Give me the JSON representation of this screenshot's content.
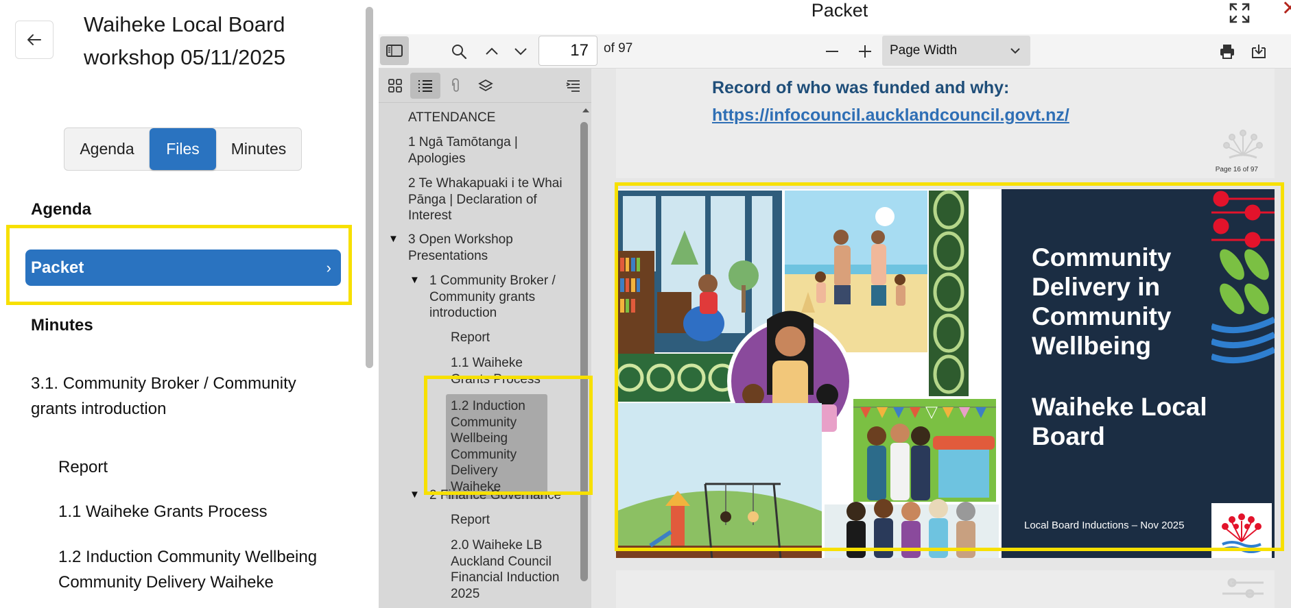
{
  "left_panel": {
    "title": "Waiheke Local Board workshop 05/11/2025",
    "segments": [
      "Agenda",
      "Files",
      "Minutes"
    ],
    "active_segment": "Files",
    "agenda_heading": "Agenda",
    "packet_label": "Packet",
    "minutes_heading": "Minutes",
    "minutes_items": [
      "3.1. Community Broker / Community grants introduction",
      "Report",
      "1.1 Waiheke Grants Process",
      "1.2 Induction Community Wellbeing Community Delivery Waiheke"
    ]
  },
  "viewer": {
    "title": "Packet",
    "current_page": "17",
    "page_total": "of 97",
    "zoom": "Page Width",
    "outline": [
      "ATTENDANCE",
      "1 Ngā Tamōtanga | Apologies",
      "2 Te Whakapuaki i te Whai Pānga | Declaration of Interest",
      "3 Open Workshop Presentations",
      "1 Community Broker / Community grants introduction",
      "Report",
      "1.1 Waiheke Grants Process",
      "1.2 Induction Community Wellbeing Community Delivery Waiheke",
      "2 Finance Governance",
      "Report",
      "2.0 Waiheke LB Auckland Council Financial Induction 2025"
    ],
    "selected_outline_item": "1.2 Induction Community Wellbeing Community Delivery Waiheke",
    "page16": {
      "heading": "Record of who was funded and why:",
      "url": "https://infocouncil.aucklandcouncil.govt.nz/",
      "page_label": "Page 16 of 97"
    },
    "slide": {
      "title": "Community Delivery in Community Wellbeing",
      "board": "Waiheke Local Board",
      "footer": "Local Board Inductions – Nov 2025"
    }
  },
  "colors": {
    "accent_blue": "#2a73c0",
    "highlight_yellow": "#f7e000",
    "slide_navy": "#1b2d43",
    "link_blue": "#2f6fb5"
  },
  "icons": [
    "back-arrow-icon",
    "chevron-right-icon",
    "fullscreen-icon",
    "close-icon",
    "sidebar-toggle-icon",
    "search-icon",
    "chevron-up-icon",
    "chevron-down-icon",
    "zoom-out-icon",
    "zoom-in-icon",
    "print-icon",
    "save-icon",
    "thumbnails-icon",
    "outline-icon",
    "attachments-icon",
    "layers-icon",
    "current-outline-item-icon"
  ]
}
